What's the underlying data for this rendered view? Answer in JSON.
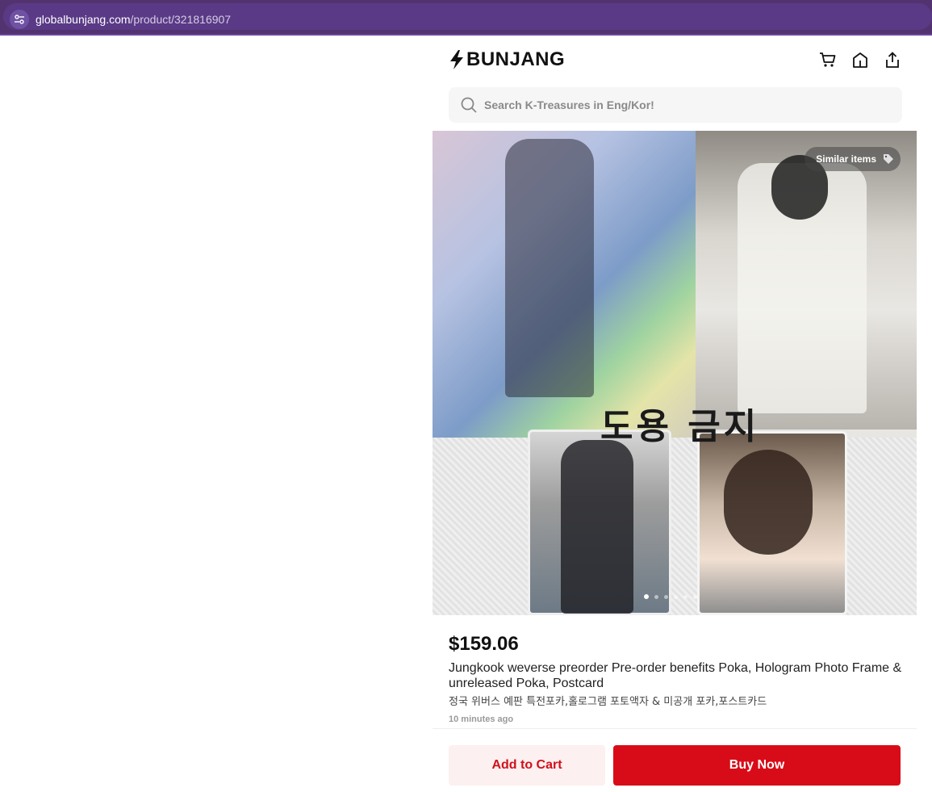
{
  "browser": {
    "url_domain": "globalbunjang.com",
    "url_path": "/product/321816907"
  },
  "header": {
    "logo_text": "BUNJANG",
    "icons": [
      "cart-icon",
      "home-icon",
      "share-icon"
    ]
  },
  "search": {
    "placeholder": "Search K-Treasures in Eng/Kor!"
  },
  "gallery": {
    "similar_items_label": "Similar items",
    "watermark": "도용 금지",
    "total_images": 6,
    "active_index": 0
  },
  "product": {
    "price": "$159.06",
    "title": "Jungkook weverse preorder Pre-order benefits Poka, Hologram Photo Frame & unreleased Poka, Postcard",
    "subtitle": "정국 위버스 예판 특전포카,홀로그램 포토액자 & 미공개 포카,포스트카드",
    "posted": "10 minutes ago"
  },
  "actions": {
    "add_to_cart": "Add to Cart",
    "buy_now": "Buy Now"
  },
  "colors": {
    "browser_bar": "#53336f",
    "brand_red": "#d80c18",
    "cart_bg": "#fdf0f0"
  }
}
